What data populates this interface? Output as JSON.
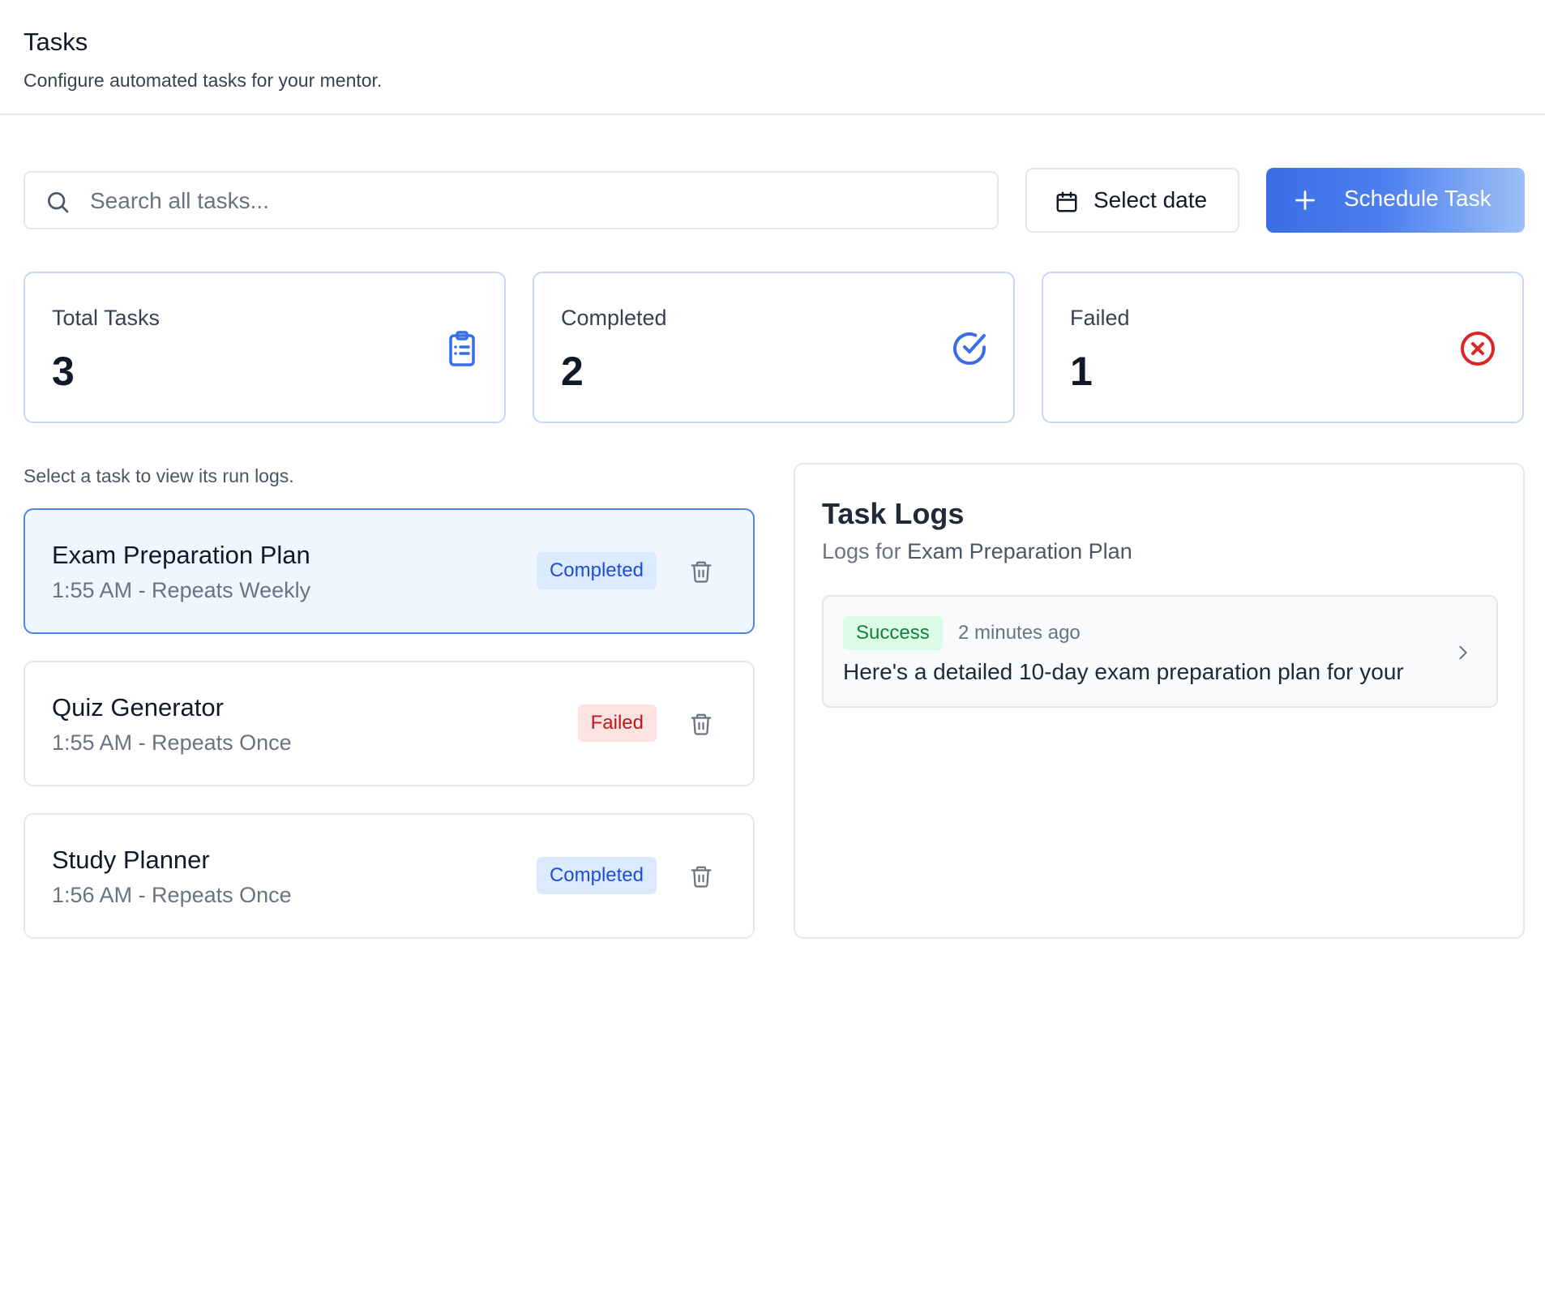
{
  "header": {
    "title": "Tasks",
    "subtitle": "Configure automated tasks for your mentor."
  },
  "toolbar": {
    "search_placeholder": "Search all tasks...",
    "search_value": "",
    "date_label": "Select date",
    "schedule_label": "Schedule Task"
  },
  "stats": [
    {
      "label": "Total Tasks",
      "value": "3",
      "icon": "clipboard-list-icon",
      "color": "#3b6ee6"
    },
    {
      "label": "Completed",
      "value": "2",
      "icon": "check-circle-icon",
      "color": "#3b6ee6"
    },
    {
      "label": "Failed",
      "value": "1",
      "icon": "x-circle-icon",
      "color": "#dc2626"
    }
  ],
  "helper_text": "Select a task to view its run logs.",
  "tasks": [
    {
      "name": "Exam Preparation Plan",
      "meta": "1:55 AM - Repeats Weekly",
      "status": "Completed",
      "selected": true
    },
    {
      "name": "Quiz Generator",
      "meta": "1:55 AM - Repeats Once",
      "status": "Failed",
      "selected": false
    },
    {
      "name": "Study Planner",
      "meta": "1:56 AM - Repeats Once",
      "status": "Completed",
      "selected": false
    }
  ],
  "logs": {
    "title": "Task Logs",
    "subtitle_prefix": "Logs for ",
    "subtitle_task": "Exam Preparation Plan",
    "entries": [
      {
        "status": "Success",
        "time": "2 minutes ago",
        "text": "Here's a detailed 10-day exam preparation plan for your"
      }
    ]
  },
  "colors": {
    "accent": "#3b6ee6",
    "completed_badge_bg": "#dbeafe",
    "completed_badge_text": "#1d4ed8",
    "failed_badge_bg": "#fde2e2",
    "failed_badge_text": "#b91c1c",
    "success_badge_bg": "#dcfce7",
    "success_badge_text": "#15803d"
  }
}
